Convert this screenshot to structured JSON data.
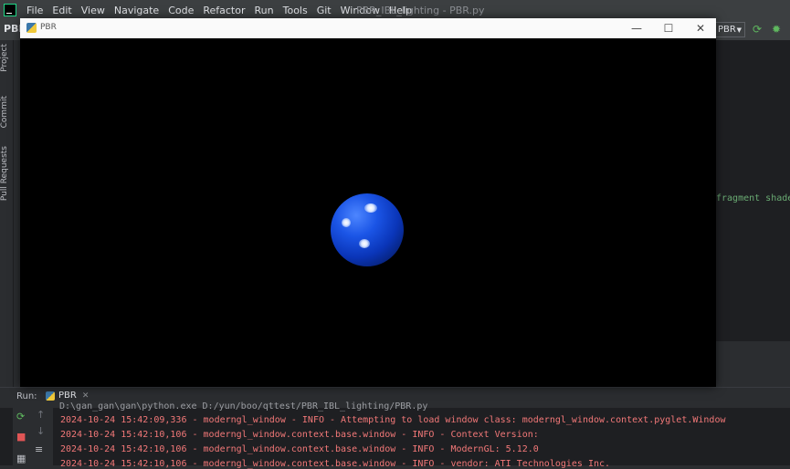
{
  "ide": {
    "project_short": "PBR",
    "menu": [
      "File",
      "Edit",
      "View",
      "Navigate",
      "Code",
      "Refactor",
      "Run",
      "Tools",
      "Git",
      "Window",
      "Help"
    ],
    "title": "PBR_IBL_lighting - PBR.py",
    "run_config": "PBR",
    "side_tabs": [
      "Project",
      "Commit",
      "Pull Requests"
    ],
    "editor_snippet": "fragment shade"
  },
  "app_window": {
    "title": "PBR"
  },
  "run_panel": {
    "label": "Run:",
    "tab": "PBR",
    "command": "D:\\gan_gan\\gan\\python.exe D:/yun/boo/qttest/PBR_IBL_lighting/PBR.py",
    "log_lines": [
      "2024-10-24 15:42:09,336 - moderngl_window - INFO - Attempting to load window class: moderngl_window.context.pyglet.Window",
      "2024-10-24 15:42:10,106 - moderngl_window.context.base.window - INFO - Context Version:",
      "2024-10-24 15:42:10,106 - moderngl_window.context.base.window - INFO - ModernGL: 5.12.0",
      "2024-10-24 15:42:10,106 - moderngl_window.context.base.window - INFO - vendor: ATI Technologies Inc."
    ]
  },
  "colors": {
    "sphere": "#1b55e6",
    "log_text": "#f27878",
    "canvas": "#000000"
  }
}
